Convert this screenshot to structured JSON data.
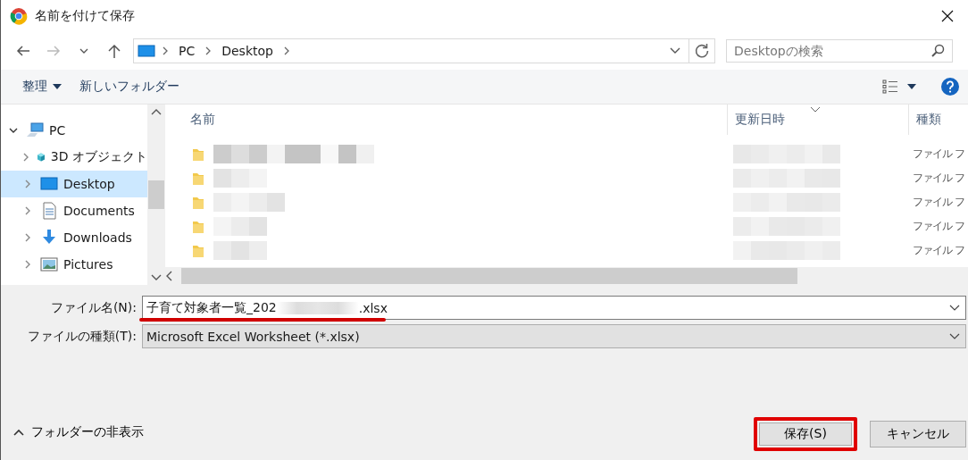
{
  "window": {
    "title": "名前を付けて保存"
  },
  "address": {
    "crumbs": [
      "PC",
      "Desktop"
    ]
  },
  "search": {
    "placeholder": "Desktopの検索"
  },
  "toolbar": {
    "organize": "整理",
    "new_folder": "新しいフォルダー"
  },
  "sidebar": {
    "items": [
      {
        "label": "PC",
        "expanded": true,
        "selected": false,
        "children": [
          {
            "label": "3D オブジェクト",
            "expanded": false,
            "selected": false
          },
          {
            "label": "Desktop",
            "expanded": false,
            "selected": true
          },
          {
            "label": "Documents",
            "expanded": false,
            "selected": false
          },
          {
            "label": "Downloads",
            "expanded": false,
            "selected": false
          },
          {
            "label": "Pictures",
            "expanded": false,
            "selected": false
          }
        ]
      }
    ]
  },
  "table": {
    "columns": [
      "名前",
      "更新日時",
      "種類"
    ],
    "rows": [
      {
        "type": "ファイル フ"
      },
      {
        "type": "ファイル フ"
      },
      {
        "type": "ファイル フ"
      },
      {
        "type": "ファイル フ"
      },
      {
        "type": "ファイル フ"
      }
    ]
  },
  "form": {
    "filename_label": "ファイル名(N):",
    "filename_start": "子育て対象者一覧_202",
    "filename_end": ".xlsx",
    "filename_underlined": true,
    "filetype_label": "ファイルの種類(T):",
    "filetype": "Microsoft Excel Worksheet (*.xlsx)"
  },
  "hide_folders": "フォルダーの非表示",
  "buttons": [
    {
      "label": "保存(S)",
      "highlighted": true
    },
    {
      "label": "キャンセル",
      "highlighted": false
    }
  ]
}
